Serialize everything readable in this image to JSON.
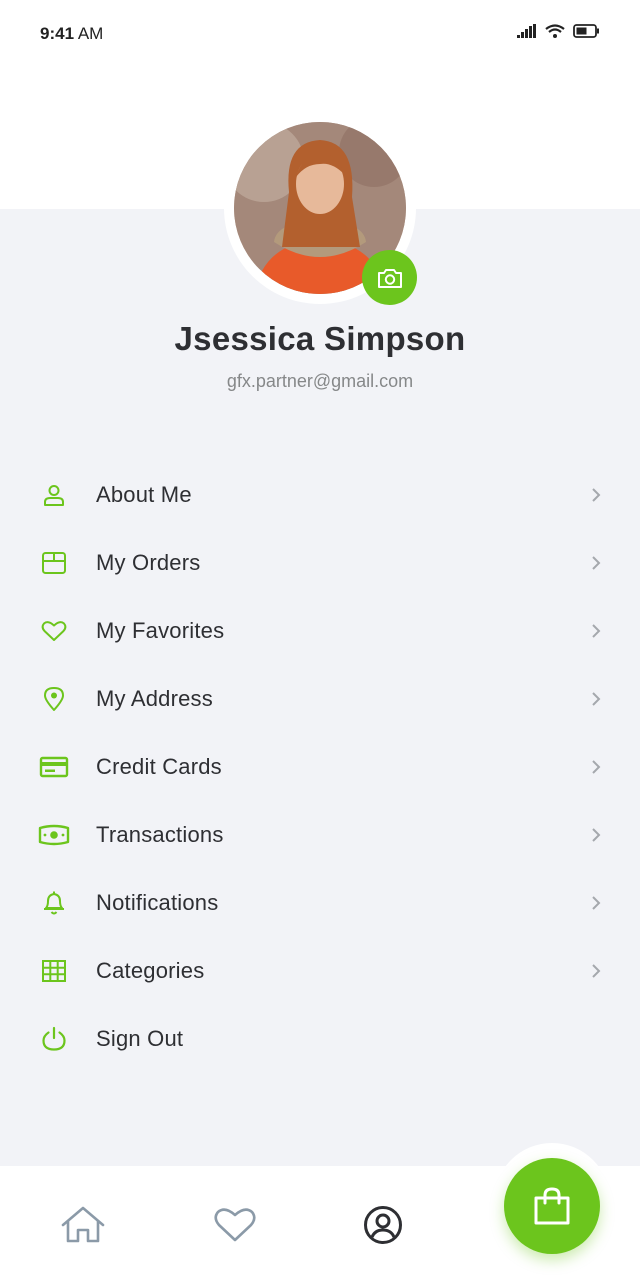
{
  "status_bar": {
    "time": "9:41",
    "ampm": "AM"
  },
  "profile": {
    "name": "Jsessica Simpson",
    "email": "gfx.partner@gmail.com"
  },
  "menu": [
    {
      "label": "About Me",
      "icon": "user-icon"
    },
    {
      "label": "My Orders",
      "icon": "box-icon"
    },
    {
      "label": "My Favorites",
      "icon": "heart-icon"
    },
    {
      "label": "My Address",
      "icon": "location-pin-icon"
    },
    {
      "label": "Credit Cards",
      "icon": "credit-card-icon"
    },
    {
      "label": "Transactions",
      "icon": "money-icon"
    },
    {
      "label": "Notifications",
      "icon": "bell-icon"
    },
    {
      "label": "Categories",
      "icon": "grid-icon"
    },
    {
      "label": "Sign Out",
      "icon": "power-icon"
    }
  ],
  "bottom_nav": [
    "home-icon",
    "heart-icon",
    "profile-icon",
    "shopping-bag-icon"
  ],
  "colors": {
    "accent": "#6cc51d",
    "panel": "#f2f3f7",
    "text": "#2e2f33",
    "muted": "#868889"
  }
}
